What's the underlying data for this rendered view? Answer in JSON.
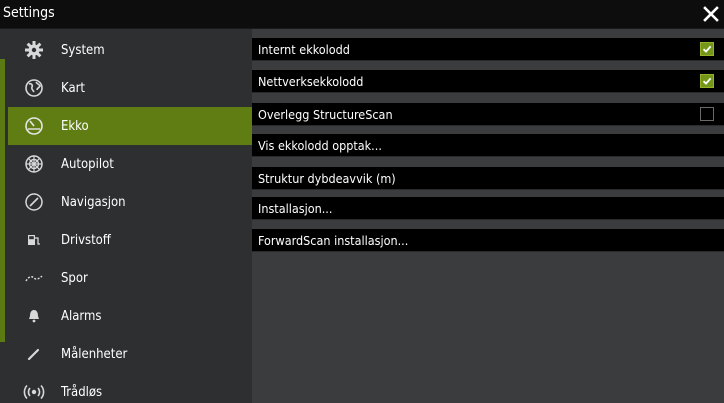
{
  "window": {
    "title": "Settings"
  },
  "sidebar": {
    "items": [
      {
        "label": "System",
        "icon": "gear-icon"
      },
      {
        "label": "Kart",
        "icon": "globe-icon"
      },
      {
        "label": "Ekko",
        "icon": "sonar-icon",
        "selected": true
      },
      {
        "label": "Autopilot",
        "icon": "helm-icon"
      },
      {
        "label": "Navigasjon",
        "icon": "compass-icon"
      },
      {
        "label": "Drivstoff",
        "icon": "fuel-pump-icon"
      },
      {
        "label": "Spor",
        "icon": "track-icon"
      },
      {
        "label": "Alarms",
        "icon": "bell-icon"
      },
      {
        "label": "Målenheter",
        "icon": "pen-icon"
      },
      {
        "label": "Trådløs",
        "icon": "wireless-icon"
      }
    ]
  },
  "settings": {
    "rows": [
      {
        "label": "Internt ekkolodd",
        "checkbox": true,
        "checked": true
      },
      {
        "label": "Nettverksekkolodd",
        "checkbox": true,
        "checked": true
      },
      {
        "label": "Overlegg StructureScan",
        "checkbox": true,
        "checked": false
      },
      {
        "label": "Vis ekkolodd opptak...",
        "checkbox": false
      },
      {
        "label": "Struktur dybdeavvik (m)",
        "checkbox": false
      },
      {
        "label": "Installasjon...",
        "checkbox": false
      },
      {
        "label": "ForwardScan installasjon...",
        "checkbox": false
      }
    ]
  },
  "colors": {
    "accent": "#5f7d13",
    "sidebar_bg": "#2d2f31",
    "content_bg": "#3a3c3e"
  }
}
